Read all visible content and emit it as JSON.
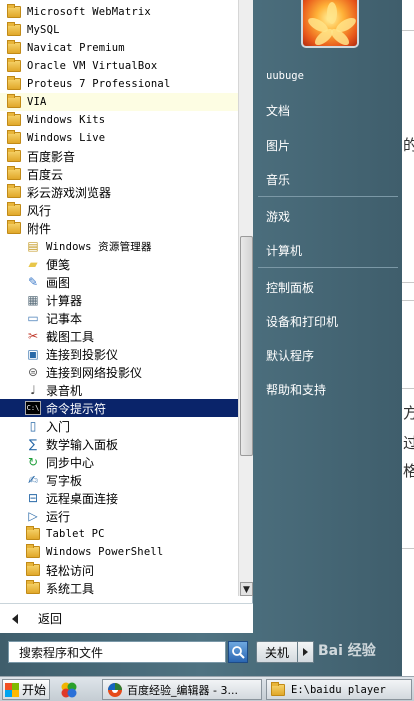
{
  "programs": [
    {
      "label": "Microsoft WebMatrix",
      "icon": "folder-icon",
      "font": "mono",
      "level": 1
    },
    {
      "label": "MySQL",
      "icon": "folder-icon",
      "font": "mono",
      "level": 1
    },
    {
      "label": "Navicat Premium",
      "icon": "folder-icon",
      "font": "mono",
      "level": 1
    },
    {
      "label": "Oracle VM VirtualBox",
      "icon": "folder-icon",
      "font": "mono",
      "level": 1
    },
    {
      "label": "Proteus 7 Professional",
      "icon": "folder-icon",
      "font": "mono",
      "level": 1
    },
    {
      "label": "VIA",
      "icon": "folder-icon",
      "font": "mono",
      "level": 1,
      "highlight": true
    },
    {
      "label": "Windows Kits",
      "icon": "folder-icon",
      "font": "mono",
      "level": 1
    },
    {
      "label": "Windows Live",
      "icon": "folder-icon",
      "font": "mono",
      "level": 1
    },
    {
      "label": "百度影音",
      "icon": "folder-icon",
      "font": "cn",
      "level": 1
    },
    {
      "label": "百度云",
      "icon": "folder-icon",
      "font": "cn",
      "level": 1
    },
    {
      "label": "彩云游戏浏览器",
      "icon": "folder-icon",
      "font": "cn",
      "level": 1
    },
    {
      "label": "风行",
      "icon": "folder-icon",
      "font": "cn",
      "level": 1
    },
    {
      "label": "附件",
      "icon": "folder-icon",
      "font": "cn",
      "level": 1
    },
    {
      "label": "Windows 资源管理器",
      "icon": "explorer-icon",
      "font": "mono",
      "level": 2
    },
    {
      "label": "便笺",
      "icon": "sticky-notes-icon",
      "font": "cn",
      "level": 2
    },
    {
      "label": "画图",
      "icon": "paint-icon",
      "font": "cn",
      "level": 2
    },
    {
      "label": "计算器",
      "icon": "calculator-icon",
      "font": "cn",
      "level": 2
    },
    {
      "label": "记事本",
      "icon": "notepad-icon",
      "font": "cn",
      "level": 2
    },
    {
      "label": "截图工具",
      "icon": "snipping-tool-icon",
      "font": "cn",
      "level": 2
    },
    {
      "label": "连接到投影仪",
      "icon": "projector-icon",
      "font": "cn",
      "level": 2
    },
    {
      "label": "连接到网络投影仪",
      "icon": "network-projector-icon",
      "font": "cn",
      "level": 2
    },
    {
      "label": "录音机",
      "icon": "microphone-icon",
      "font": "cn",
      "level": 2
    },
    {
      "label": "命令提示符",
      "icon": "command-prompt-icon",
      "font": "cn",
      "level": 2,
      "selected": true
    },
    {
      "label": "入门",
      "icon": "getting-started-icon",
      "font": "cn",
      "level": 2
    },
    {
      "label": "数学输入面板",
      "icon": "math-input-icon",
      "font": "cn",
      "level": 2
    },
    {
      "label": "同步中心",
      "icon": "sync-center-icon",
      "font": "cn",
      "level": 2
    },
    {
      "label": "写字板",
      "icon": "wordpad-icon",
      "font": "cn",
      "level": 2
    },
    {
      "label": "远程桌面连接",
      "icon": "remote-desktop-icon",
      "font": "cn",
      "level": 2
    },
    {
      "label": "运行",
      "icon": "run-icon",
      "font": "cn",
      "level": 2
    },
    {
      "label": "Tablet PC",
      "icon": "folder-icon",
      "font": "mono",
      "level": 2
    },
    {
      "label": "Windows PowerShell",
      "icon": "folder-icon",
      "font": "mono",
      "level": 2
    },
    {
      "label": "轻松访问",
      "icon": "folder-icon",
      "font": "cn",
      "level": 2
    },
    {
      "label": "系统工具",
      "icon": "folder-icon",
      "font": "cn",
      "level": 2
    }
  ],
  "back_label": "返回",
  "search_placeholder": "搜索程序和文件",
  "right_pane": {
    "username": "uubuge",
    "items": [
      "文档",
      "图片",
      "音乐",
      "游戏",
      "计算机",
      "控制面板",
      "设备和打印机",
      "默认程序",
      "帮助和支持"
    ]
  },
  "shutdown_label": "关机",
  "taskbar": {
    "start_label": "开始",
    "tasks": [
      "百度经验_编辑器 - 3...",
      "E:\\baidu player"
    ]
  },
  "watermark": "Bai 经验",
  "background_text": [
    "的",
    "方",
    "过",
    "格"
  ],
  "colors": {
    "selection": "#0a246a",
    "hover_highlight": "#fdfde3",
    "menu_panel": "#4f7382"
  }
}
